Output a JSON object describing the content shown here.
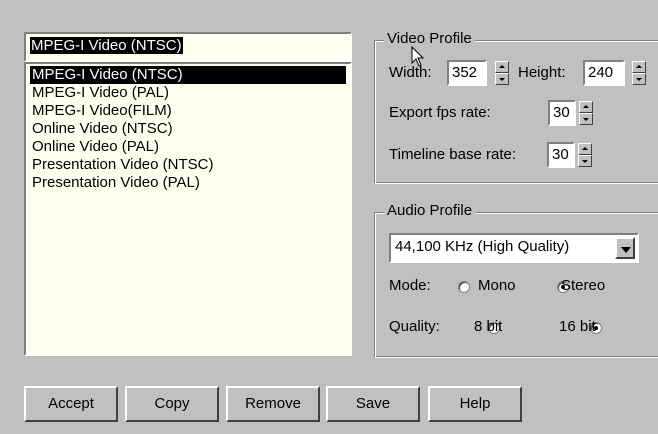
{
  "profiles": {
    "input_value": "MPEG-I Video (NTSC)",
    "items": [
      "MPEG-I Video (NTSC)",
      "MPEG-I Video (PAL)",
      "MPEG-I Video(FILM)",
      "Online Video (NTSC)",
      "Online Video (PAL)",
      "Presentation Video (NTSC)",
      "Presentation Video (PAL)"
    ],
    "selected_index": 0
  },
  "video_profile": {
    "title": "Video Profile",
    "width_label": "Width:",
    "width_value": "352",
    "height_label": "Height:",
    "height_value": "240",
    "fps_label": "Export fps rate:",
    "fps_value": "30",
    "timeline_label": "Timeline base rate:",
    "timeline_value": "30"
  },
  "audio_profile": {
    "title": "Audio Profile",
    "rate_value": "44,100 KHz (High Quality)",
    "mode_label": "Mode:",
    "mode_mono": "Mono",
    "mode_stereo": "Stereo",
    "mode_selected": "Stereo",
    "quality_label": "Quality:",
    "quality_8": "8 bit",
    "quality_16": "16 bit",
    "quality_selected": "16 bit"
  },
  "buttons": {
    "accept": "Accept",
    "copy": "Copy",
    "remove": "Remove",
    "save": "Save",
    "help": "Help"
  },
  "icons": {
    "cursor": "mouse-pointer-icon",
    "spin": "spin-arrows-icon",
    "dropdown": "chevron-down-icon"
  },
  "colors": {
    "window_bg": "#c0c0c0",
    "list_bg": "#fffff0",
    "selection_bg": "#000000",
    "selection_fg": "#ffffff"
  }
}
